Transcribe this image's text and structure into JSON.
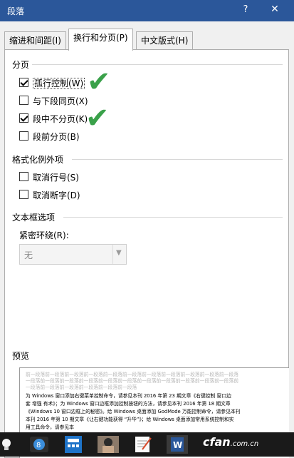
{
  "window": {
    "title": "段落",
    "help": "?",
    "close": "✕"
  },
  "tabs": [
    "缩进和间距(I)",
    "换行和分页(P)",
    "中文版式(H)"
  ],
  "pagination": {
    "heading": "分页",
    "options": [
      {
        "label": "孤行控制(W)",
        "checked": true
      },
      {
        "label": "与下段同页(X)",
        "checked": false
      },
      {
        "label": "段中不分页(K)",
        "checked": true
      },
      {
        "label": "段前分页(B)",
        "checked": false
      }
    ]
  },
  "exceptions": {
    "heading": "格式化例外项",
    "options": [
      {
        "label": "取消行号(S)",
        "checked": false
      },
      {
        "label": "取消断字(D)",
        "checked": false
      }
    ]
  },
  "textbox": {
    "heading": "文本框选项",
    "wrap_label": "紧密环绕(R):",
    "wrap_value": "无"
  },
  "preview": {
    "heading": "预览",
    "lines_before": [
      "前一段落前一段落前一段落前一段落前一段落前一段落前一段落前一段落前一段落前一段落前一段落",
      "一段落前一段落前一段落前一段落前一段落前一段落前一段落前一段落前一段落前一段落前一段落前",
      "一段落前一段落前一段落前一段落前一段落前一段落"
    ],
    "lines_body": [
      "为 Windows 窗口添加右键菜单控制命令，请参见本刊 2016 年第 23 期文章《右键控制 窗口边",
      "套  增强  有术》；为 Windows 窗口边框添加控制按钮的方法，请参见本刊 2016 年第 18 期文章",
      "《Windows 10 窗口边框上的秘密》。给 Windows 桌面添加 GodMode 万能控制命令，请参见本刊",
      "本刊 2016 年第 10 期文章《让右键功能获得 “升华”》；给 Windows 桌面添加常用系统控制和实",
      "用工具命令，请参见本"
    ]
  },
  "taskbar": {
    "watermark": "cfan",
    "watermark_suffix": ".com.cn"
  }
}
